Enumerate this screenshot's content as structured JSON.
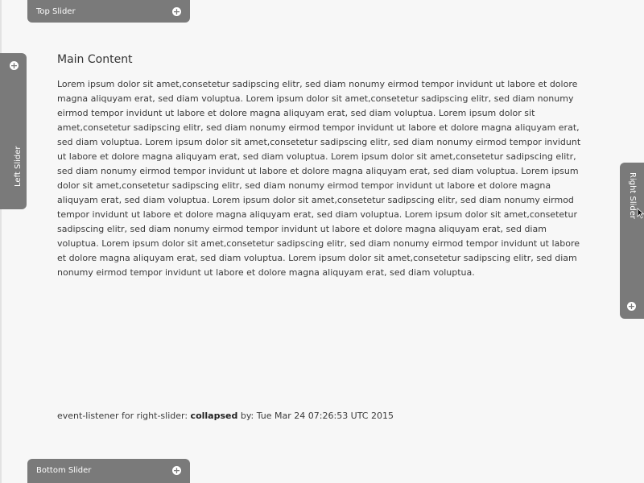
{
  "sliders": {
    "top": {
      "label": "Top Slider"
    },
    "bottom": {
      "label": "Bottom Slider"
    },
    "left": {
      "label": "Left Slider"
    },
    "right": {
      "label": "Right Slider"
    }
  },
  "main": {
    "title": "Main Content",
    "text": "Lorem ipsum dolor sit amet,consetetur sadipscing elitr, sed diam nonumy eirmod tempor invidunt ut labore et dolore magna aliquyam erat, sed diam voluptua. Lorem ipsum dolor sit amet,consetetur sadipscing elitr, sed diam nonumy eirmod tempor invidunt ut labore et dolore magna aliquyam erat, sed diam voluptua. Lorem ipsum dolor sit amet,consetetur sadipscing elitr, sed diam nonumy eirmod tempor invidunt ut labore et dolore magna aliquyam erat, sed diam voluptua. Lorem ipsum dolor sit amet,consetetur sadipscing elitr, sed diam nonumy eirmod tempor invidunt ut labore et dolore magna aliquyam erat, sed diam voluptua. Lorem ipsum dolor sit amet,consetetur sadipscing elitr, sed diam nonumy eirmod tempor invidunt ut labore et dolore magna aliquyam erat, sed diam voluptua. Lorem ipsum dolor sit amet,consetetur sadipscing elitr, sed diam nonumy eirmod tempor invidunt ut labore et dolore magna aliquyam erat, sed diam voluptua. Lorem ipsum dolor sit amet,consetetur sadipscing elitr, sed diam nonumy eirmod tempor invidunt ut labore et dolore magna aliquyam erat, sed diam voluptua. Lorem ipsum dolor sit amet,consetetur sadipscing elitr, sed diam nonumy eirmod tempor invidunt ut labore et dolore magna aliquyam erat, sed diam voluptua. Lorem ipsum dolor sit amet,consetetur sadipscing elitr, sed diam nonumy eirmod tempor invidunt ut labore et dolore magna aliquyam erat, sed diam voluptua. Lorem ipsum dolor sit amet,consetetur sadipscing elitr, sed diam nonumy eirmod tempor invidunt ut labore et dolore magna aliquyam erat, sed diam voluptua."
  },
  "event": {
    "prefix": "event-listener for right-slider:",
    "state": "collapsed",
    "suffix": "by: Tue Mar 24 07:26:53 UTC 2015"
  },
  "icons": {
    "expand": "plus-circle-icon",
    "cursor": "arrow-cursor-icon"
  },
  "colors": {
    "slider_bg": "#7a7a7a",
    "page_bg": "#f7f7f7",
    "text": "#3a3a3a"
  }
}
